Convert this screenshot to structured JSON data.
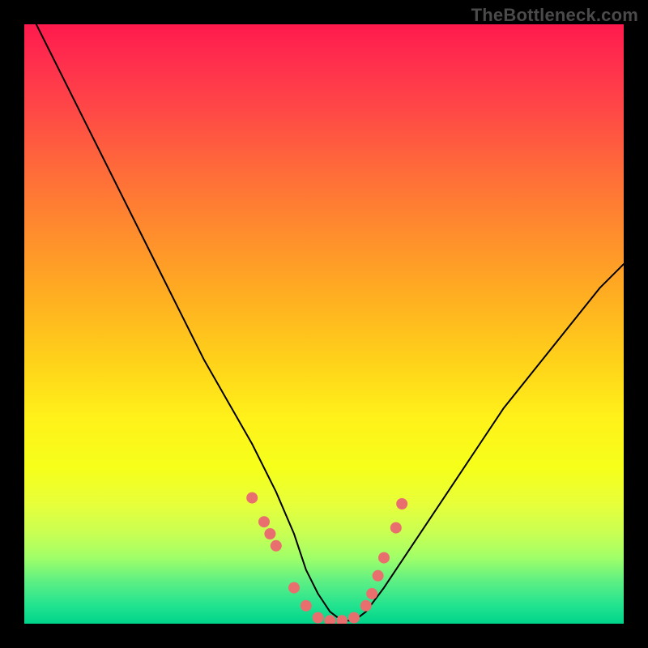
{
  "watermark": "TheBottleneck.com",
  "accent": {
    "dot_color": "#e96f6f"
  },
  "chart_data": {
    "type": "line",
    "title": "",
    "xlabel": "",
    "ylabel": "",
    "xlim": [
      0,
      100
    ],
    "ylim": [
      0,
      100
    ],
    "grid": false,
    "legend": false,
    "series": [
      {
        "name": "bottleneck-curve",
        "x": [
          2,
          6,
          10,
          14,
          18,
          22,
          26,
          30,
          34,
          38,
          42,
          45,
          47,
          49,
          51,
          53,
          55,
          57,
          60,
          64,
          68,
          72,
          76,
          80,
          84,
          88,
          92,
          96,
          100
        ],
        "y": [
          100,
          92,
          84,
          76,
          68,
          60,
          52,
          44,
          37,
          30,
          22,
          15,
          9,
          5,
          2,
          0.5,
          0.5,
          2,
          6,
          12,
          18,
          24,
          30,
          36,
          41,
          46,
          51,
          56,
          60
        ]
      }
    ],
    "datapoints": {
      "name": "measurement-dots",
      "x": [
        38,
        40,
        41,
        42,
        45,
        47,
        49,
        51,
        53,
        55,
        57,
        58,
        59,
        60,
        62,
        63
      ],
      "y": [
        21,
        17,
        15,
        13,
        6,
        3,
        1,
        0.5,
        0.5,
        1,
        3,
        5,
        8,
        11,
        16,
        20
      ]
    },
    "green_band": {
      "y_from": 0,
      "y_to": 5,
      "comment": "optimal zone near x-axis where curve bottoms out"
    }
  }
}
